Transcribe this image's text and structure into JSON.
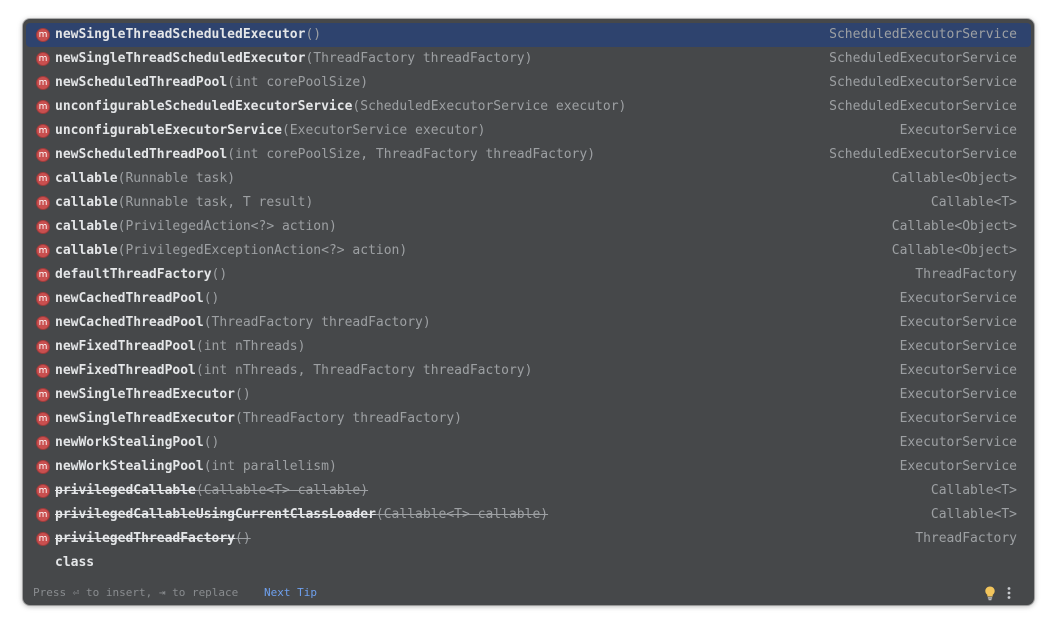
{
  "completion": {
    "method_icon": "m",
    "items": [
      {
        "name": "newSingleThreadScheduledExecutor",
        "params": "()",
        "type": "ScheduledExecutorService"
      },
      {
        "name": "newSingleThreadScheduledExecutor",
        "params": "(ThreadFactory threadFactory)",
        "type": "ScheduledExecutorService"
      },
      {
        "name": "newScheduledThreadPool",
        "params": "(int corePoolSize)",
        "type": "ScheduledExecutorService"
      },
      {
        "name": "unconfigurableScheduledExecutorService",
        "params": "(ScheduledExecutorService executor)",
        "type": "ScheduledExecutorService"
      },
      {
        "name": "unconfigurableExecutorService",
        "params": "(ExecutorService executor)",
        "type": "ExecutorService"
      },
      {
        "name": "newScheduledThreadPool",
        "params": "(int corePoolSize, ThreadFactory threadFactory)",
        "type": "ScheduledExecutorService"
      },
      {
        "name": "callable",
        "params": "(Runnable task)",
        "type": "Callable<Object>"
      },
      {
        "name": "callable",
        "params": "(Runnable task, T result)",
        "type": "Callable<T>"
      },
      {
        "name": "callable",
        "params": "(PrivilegedAction<?> action)",
        "type": "Callable<Object>"
      },
      {
        "name": "callable",
        "params": "(PrivilegedExceptionAction<?> action)",
        "type": "Callable<Object>"
      },
      {
        "name": "defaultThreadFactory",
        "params": "()",
        "type": "ThreadFactory"
      },
      {
        "name": "newCachedThreadPool",
        "params": "()",
        "type": "ExecutorService"
      },
      {
        "name": "newCachedThreadPool",
        "params": "(ThreadFactory threadFactory)",
        "type": "ExecutorService"
      },
      {
        "name": "newFixedThreadPool",
        "params": "(int nThreads)",
        "type": "ExecutorService"
      },
      {
        "name": "newFixedThreadPool",
        "params": "(int nThreads, ThreadFactory threadFactory)",
        "type": "ExecutorService"
      },
      {
        "name": "newSingleThreadExecutor",
        "params": "()",
        "type": "ExecutorService"
      },
      {
        "name": "newSingleThreadExecutor",
        "params": "(ThreadFactory threadFactory)",
        "type": "ExecutorService"
      },
      {
        "name": "newWorkStealingPool",
        "params": "()",
        "type": "ExecutorService"
      },
      {
        "name": "newWorkStealingPool",
        "params": "(int parallelism)",
        "type": "ExecutorService"
      },
      {
        "name": "privilegedCallable",
        "params": "(Callable<T> callable)",
        "type": "Callable<T>"
      },
      {
        "name": "privilegedCallableUsingCurrentClassLoader",
        "params": "(Callable<T> callable)",
        "type": "Callable<T>"
      },
      {
        "name": "privilegedThreadFactory",
        "params": "()",
        "type": "ThreadFactory"
      },
      {
        "name": "class",
        "params": "",
        "type": ""
      }
    ]
  },
  "footer": {
    "hint": "Press ⏎ to insert, ⇥ to replace",
    "next_tip": "Next Tip",
    "bulb_icon": "lightbulb-icon",
    "more_icon": "more-vertical-icon"
  },
  "colors": {
    "popup_bg": "#46484a",
    "selected_bg": "#2e436e",
    "method_icon": "#c94f4f",
    "link": "#6ea0ee"
  }
}
